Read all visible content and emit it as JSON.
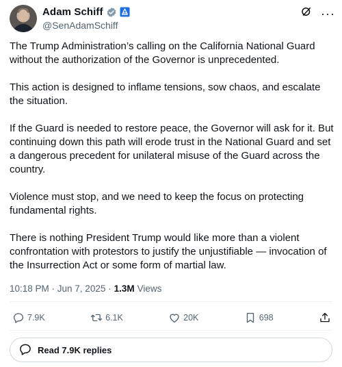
{
  "author": {
    "name": "Adam Schiff",
    "handle": "@SenAdamSchiff",
    "verified_color": "#829aab",
    "badge_color": "#1d6fe0"
  },
  "tweet": {
    "paragraphs": [
      "The Trump Administration’s calling on the California National Guard without the authorization of the Governor is unprecedented.",
      "This action is designed to inflame tensions, sow chaos, and escalate the situation.",
      "If the Guard is needed to restore peace, the Governor will ask for it. But continuing down this path will erode trust in the National Guard and set a dangerous precedent for unilateral misuse of the Guard across the country.",
      "Violence must stop, and we need to keep the focus on protecting fundamental rights.",
      "There is nothing President Trump would like more than a violent confrontation with protestors to justify the unjustifiable — invocation of the Insurrection Act or some form of martial law."
    ],
    "timestamp": "10:18 PM · Jun 7, 2025 ·",
    "views_count": "1.3M",
    "views_label": "Views"
  },
  "actions": {
    "replies": "7.9K",
    "reposts": "6.1K",
    "likes": "20K",
    "bookmarks": "698"
  },
  "icons": {
    "reply": "reply-icon",
    "repost": "repost-icon",
    "like": "heart-icon",
    "bookmark": "bookmark-icon",
    "share": "share-icon",
    "grok": "grok-icon",
    "more": "more-icon"
  },
  "replies_button": {
    "label": "Read 7.9K replies"
  }
}
